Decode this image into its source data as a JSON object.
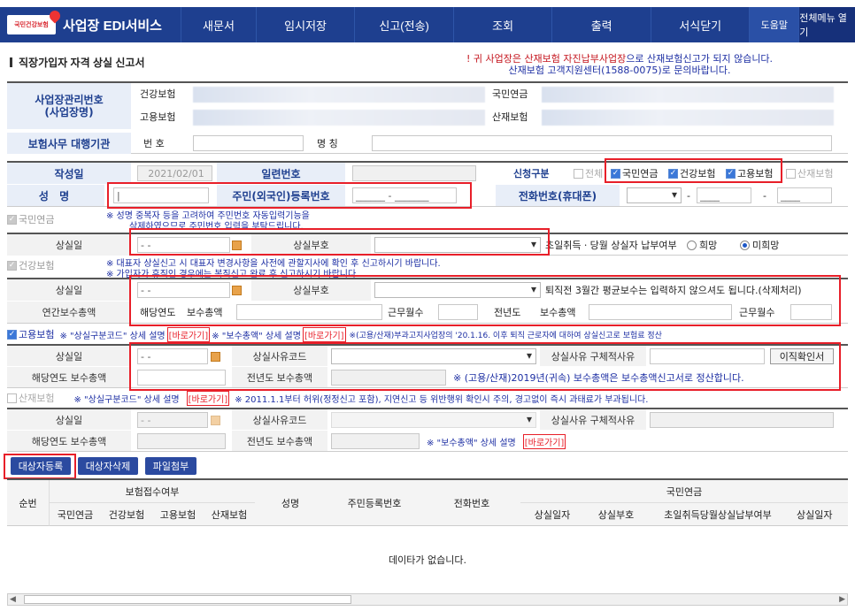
{
  "nav": {
    "logo_text": "국민건강보험",
    "title": "사업장 EDI서비스",
    "items": [
      "새문서",
      "임시저장",
      "신고(전송)",
      "조회",
      "출력",
      "서식닫기"
    ],
    "help": "도움말",
    "all_menu": "전체메뉴 열기"
  },
  "page": {
    "title": "직장가입자 자격 상실 신고서",
    "notice_line1_a": "! 귀 사업장은 ",
    "notice_line1_b": "산재보험 자진납부사업장",
    "notice_line1_c": "으로 산재보험신고가 되지 않습니다.",
    "notice_line2": "산재보험 고객지원센터(1588-0075)로 문의바랍니다."
  },
  "biz": {
    "label": "사업장관리번호\n(사업장명)",
    "health": "건강보험",
    "pension": "국민연금",
    "employ": "고용보험",
    "accident": "산재보험",
    "agent_label": "보험사무 대행기관",
    "num_label": "번 호",
    "name_label": "명 칭"
  },
  "form": {
    "date_label": "작성일",
    "date": "2021/02/01",
    "serial_label": "일련번호",
    "apply_label": "신청구분",
    "all": "전체",
    "opt_pension": "국민연금",
    "opt_health": "건강보험",
    "opt_employ": "고용보험",
    "opt_accident": "산재보험",
    "name_label": "성    명",
    "rrn_label": "주민(외국인)등록번호",
    "rrn_value": "______ - _______",
    "phone_label": "전화번호(휴대폰)",
    "phone_mid": "____",
    "phone_end": "____"
  },
  "pension": {
    "tag": "국민연금",
    "note1": "※ 성명 중복자 등을 고려하여 주민번호 자동입력기능을",
    "note2": "삭제하였으므로 주민번호 입력을 부탁드립니다.",
    "loss_date": "상실일",
    "date_val": "- -",
    "loss_code": "상실부호",
    "pay_label": "초일취득ㆍ당월 상실자 납부여부",
    "hope": "희망",
    "nohope": "미희망"
  },
  "health": {
    "tag": "건강보험",
    "note1": "※ 대표자 상실신고 시 대표자 변경사항을 사전에 관할지사에 확인 후 신고하시기 바랍니다.",
    "note2": "※ 가입자가 휴직인 경우에는 복직신고 완료 후 신고하시기 바랍니다.",
    "loss_date": "상실일",
    "date_val": "- -",
    "loss_code": "상실부호",
    "avg_note": "퇴직전 3월간 평균보수는 입력하지 않으셔도 됩니다.(삭제처리)",
    "annual": "연간보수총액",
    "cur_year": "해당연도",
    "total": "보수총액",
    "months": "근무월수",
    "prev_year": "전년도",
    "prev_total": "보수총액",
    "prev_months": "근무월수"
  },
  "employ": {
    "tag": "고용보험",
    "note_a": "※ \"상실구분코드\" 상세 설명",
    "go": "[바로가기]",
    "note_b": "※ \"보수총액\" 상세 설명",
    "note_c": "※(고용/산재)부과고지사업장의 '20.1.16. 이후 퇴직 근로자에 대하여 상실신고로 보험료 정산",
    "loss_date": "상실일",
    "date_val": "- -",
    "reason_code": "상실사유코드",
    "reason_detail": "상실사유 구체적사유",
    "transfer_btn": "이직확인서",
    "cur_total": "해당연도 보수총액",
    "prev_total": "전년도 보수총액",
    "settle_note": "※ (고용/산재)2019년(귀속) 보수총액은 보수총액신고서로 정산합니다."
  },
  "accident": {
    "tag": "산재보험",
    "note_a": "※ \"상실구분코드\" 상세 설명",
    "go": "[바로가기]",
    "note_b": "※ 2011.1.1부터 허위(정정신고 포함), 지연신고 등 위반행위 확인시 주의, 경고없이 즉시 과태료가 부과됩니다.",
    "loss_date": "상실일",
    "date_val": "- -",
    "reason_code": "상실사유코드",
    "reason_detail": "상실사유 구체적사유",
    "cur_total": "해당연도 보수총액",
    "prev_total": "전년도 보수총액",
    "sum_note": "※ \"보수총액\" 상세 설명",
    "go2": "[바로가기]"
  },
  "buttons": {
    "register": "대상자등록",
    "delete": "대상자삭제",
    "attach": "파일첨부"
  },
  "grid": {
    "seq": "순번",
    "recv": "보험접수여부",
    "c_pension": "국민연금",
    "c_health": "건강보험",
    "c_employ": "고용보험",
    "c_accident": "산재보험",
    "name": "성명",
    "rrn": "주민등록번호",
    "phone": "전화번호",
    "pension_grp": "국민연금",
    "loss_date": "상실일자",
    "loss_code": "상실부호",
    "pay_yn": "초일취득당월상실납부여부",
    "loss_date2": "상실일자",
    "empty": "데이타가 없습니다."
  },
  "colors": {
    "nav": "#1e3f8f",
    "label_bg": "#e8eef8",
    "highlight": "#e81f29"
  }
}
